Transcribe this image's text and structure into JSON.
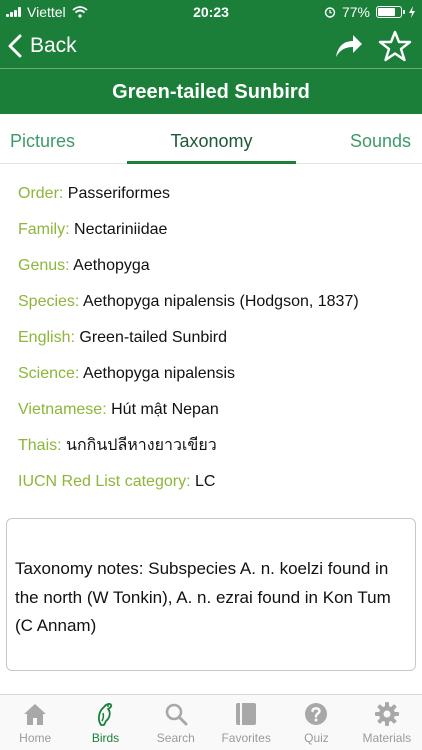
{
  "status_bar": {
    "carrier": "Viettel",
    "time": "20:23",
    "battery": "77%",
    "battery_level": 0.77
  },
  "nav": {
    "back_label": "Back"
  },
  "title": "Green-tailed Sunbird",
  "tabs": [
    {
      "label": "Pictures"
    },
    {
      "label": "Taxonomy",
      "selected": true
    },
    {
      "label": "Sounds"
    }
  ],
  "taxonomy": {
    "order": {
      "key": "Order:",
      "value": "Passeriformes"
    },
    "family": {
      "key": "Family:",
      "value": "Nectariniidae"
    },
    "genus": {
      "key": "Genus:",
      "value": "Aethopyga"
    },
    "species": {
      "key": "Species:",
      "value": "Aethopyga nipalensis (Hodgson, 1837)"
    },
    "english": {
      "key": "English:",
      "value": "Green-tailed Sunbird"
    },
    "science": {
      "key": "Science:",
      "value": "Aethopyga nipalensis"
    },
    "vietnamese": {
      "key": "Vietnamese:",
      "value": "Hút mật Nepan"
    },
    "thais": {
      "key": "Thais:",
      "value": "นกกินปลีหางยาวเขียว"
    },
    "iucn": {
      "key": "IUCN Red List category:",
      "value": "LC"
    }
  },
  "notes": "Taxonomy notes: Subspecies A. n. koelzi found in the north (W Tonkin), A. n. ezrai found in Kon Tum (C Annam)",
  "tabbar": [
    {
      "label": "Home",
      "icon": "home-icon"
    },
    {
      "label": "Birds",
      "icon": "bird-icon",
      "active": true
    },
    {
      "label": "Search",
      "icon": "search-icon"
    },
    {
      "label": "Favorites",
      "icon": "book-icon"
    },
    {
      "label": "Quiz",
      "icon": "question-icon"
    },
    {
      "label": "Materials",
      "icon": "gear-icon"
    }
  ],
  "colors": {
    "primary": "#1b7f3a",
    "key_label": "#8db63a",
    "tab_text": "#3f9a69",
    "inactive": "#9b9b9b"
  }
}
